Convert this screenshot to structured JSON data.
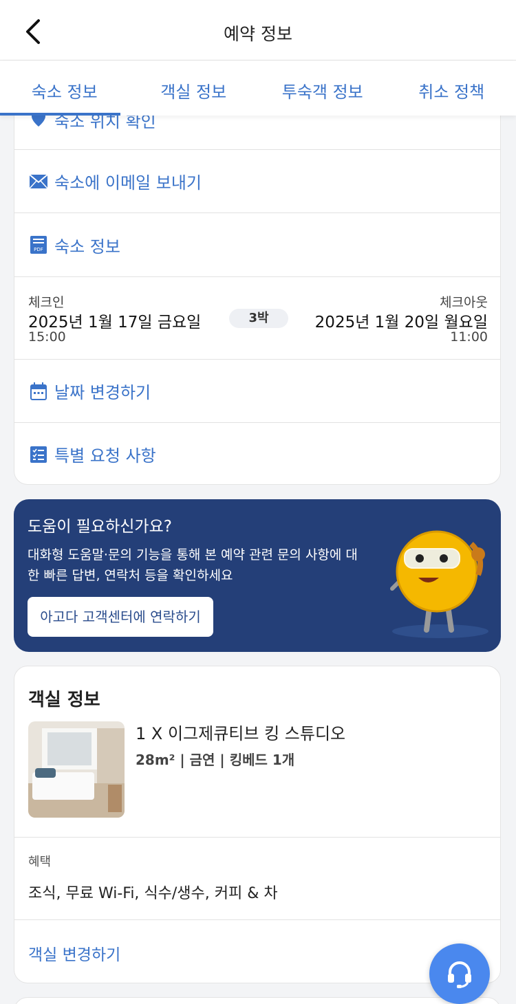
{
  "header": {
    "title": "예약 정보"
  },
  "tabs": [
    {
      "label": "숙소 정보",
      "active": true
    },
    {
      "label": "객실 정보"
    },
    {
      "label": "투숙객 정보"
    },
    {
      "label": "취소 정책"
    }
  ],
  "property": {
    "location_label": "숙소 위치 확인",
    "email_label": "숙소에 이메일 보내기",
    "info_label": "숙소 정보",
    "change_dates_label": "날짜 변경하기",
    "special_requests_label": "특별 요청 사항"
  },
  "stay": {
    "checkin_label": "체크인",
    "checkin_date": "2025년 1월 17일 금요일",
    "checkin_time": "15:00",
    "nights": "3박",
    "checkout_label": "체크아웃",
    "checkout_date": "2025년 1월 20일 월요일",
    "checkout_time": "11:00"
  },
  "help": {
    "title": "도움이 필요하신가요?",
    "description": "대화형 도움말·문의 기능을 통해 본 예약 관련 문의 사항에 대한 빠른 답변, 연락처 등을 확인하세요",
    "button_label": "아고다 고객센터에 연락하기"
  },
  "room": {
    "section_title": "객실 정보",
    "name": "1 X 이그제큐티브 킹 스튜디오",
    "meta": "28m² | 금연 | 킹베드 1개",
    "benefits_label": "혜택",
    "benefits": "조식, 무료 Wi-Fi, 식수/생수, 커피 & 차",
    "change_room_label": "객실 변경하기"
  },
  "colors": {
    "accent": "#3a73c9",
    "help_bg": "#243f78",
    "fab": "#4a88ee"
  },
  "icons": [
    "back-icon",
    "location-pin-icon",
    "mail-icon",
    "pdf-icon",
    "calendar-icon",
    "checklist-icon",
    "headset-icon"
  ]
}
